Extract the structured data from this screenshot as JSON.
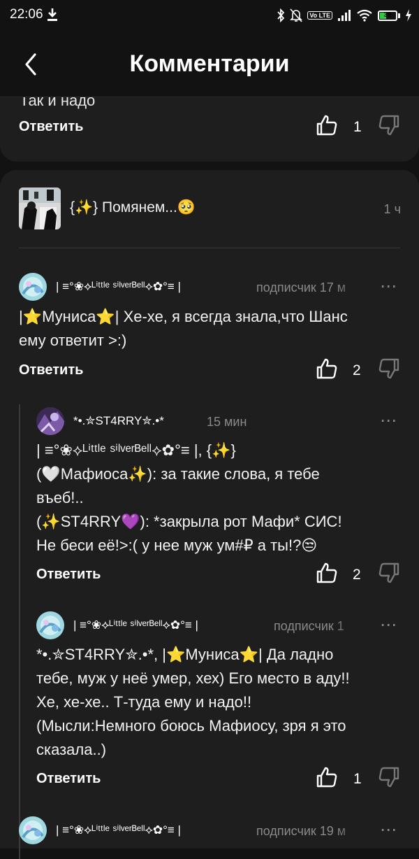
{
  "status_bar": {
    "time": "22:06",
    "volte": "Vo LTE",
    "battery": "39"
  },
  "header": {
    "title": "Комментарии"
  },
  "top_card": {
    "cut_text": "Так и надо",
    "reply_label": "Ответить",
    "likes": "1"
  },
  "post": {
    "title": "{✨} Помянем...🥺",
    "time": "1 ч"
  },
  "comments": [
    {
      "author": "| ≡°❀⟡ᴸⁱᵗᵗˡᵉ ˢⁱˡᵛᵉʳᴮᵉˡˡ⟡✿°≡ |",
      "meta": "подписчик  17 м",
      "text": "|⭐Муниса⭐| Хе-хе, я всегда знала,что Шанс\nему ответит >:)",
      "reply_label": "Ответить",
      "likes": "2"
    },
    {
      "author": "*•.✮ST4RRY✮.•*",
      "meta": "15 мин",
      "text": "| ≡°❀⟡ᴸⁱᵗᵗˡᵉ ˢⁱˡᵛᵉʳᴮᵉˡˡ⟡✿°≡ |, {✨}\n(🤍Мафиоса✨): за такие слова, я тебе\nвъеб!..\n(✨ST4RRY💜): *закрыла рот Мафи* СИС!\nНе беси её!>:( у нее муж ум#₽ а ты!?😒",
      "reply_label": "Ответить",
      "likes": "2"
    },
    {
      "author": "| ≡°❀⟡ᴸⁱᵗᵗˡᵉ ˢⁱˡᵛᵉʳᴮᵉˡˡ⟡✿°≡ |",
      "meta": "подписчик  1",
      "text": "*•.✮ST4RRY✮.•*, |⭐Муниса⭐| Да ладно\nтебе, муж у неё умер, хех) Его место в аду!!\nХе, хе-хе.. Т-туда ему и надо!!\n(Мысли:Немного боюсь Мафиосу, зря я это\nсказала..)",
      "reply_label": "Ответить",
      "likes": "1"
    },
    {
      "author": "| ≡°❀⟡ᴸⁱᵗᵗˡᵉ ˢⁱˡᵛᵉʳᴮᵉˡˡ⟡✿°≡ |",
      "meta": "подписчик  19 м"
    }
  ],
  "more_icon": "⋯"
}
